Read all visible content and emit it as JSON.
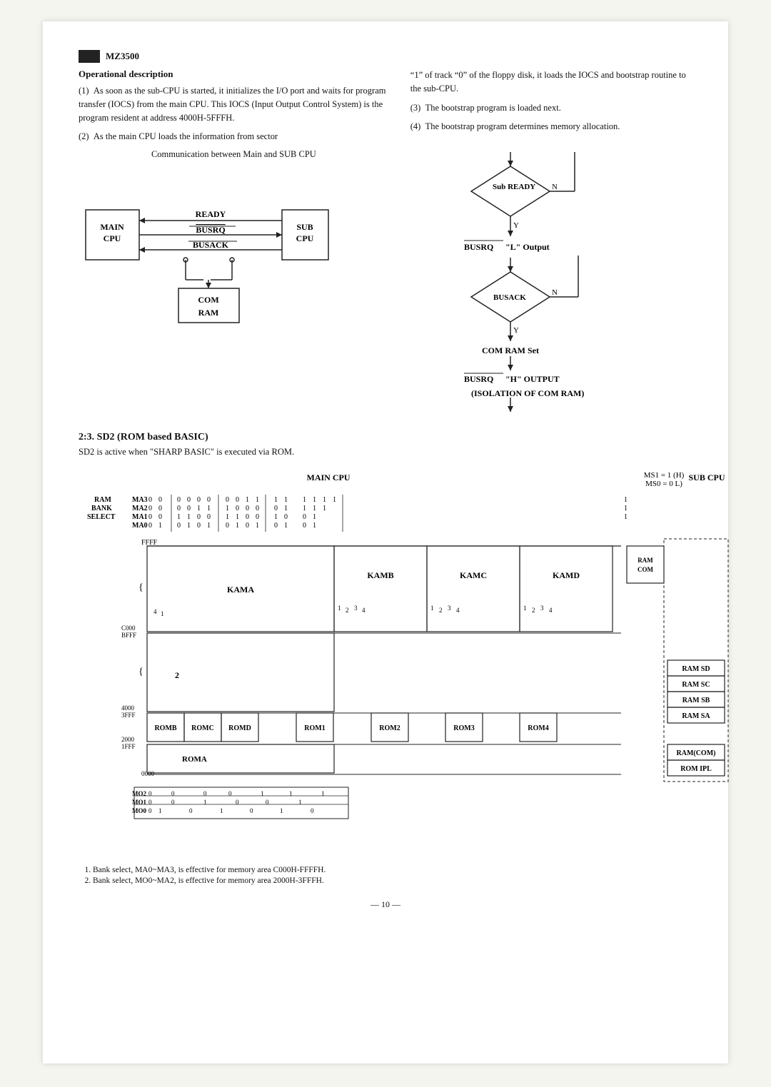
{
  "header": {
    "logo_alt": "MZ3500 logo bar",
    "model": "MZ3500"
  },
  "operational": {
    "title": "Operational description",
    "items": [
      "(1)  As soon as the sub-CPU is started, it initializes the I/O port and waits for program transfer (IOCS) from the main CPU. This IOCS (Input Output Control System) is the program resident at address 4000H-5FFFH.",
      "(2)  As the main CPU loads the information from sector",
      "\"1\" of track \"0\" of the floppy disk, it loads the IOCS and bootstrap routine to the sub-CPU.",
      "(3)  The bootstrap program is loaded next.",
      "(4)  The bootstrap program determines memory allocation."
    ]
  },
  "comm_diagram": {
    "title": "Communication between Main and SUB CPU",
    "main_cpu": "MAIN\nCPU",
    "sub_cpu": "SUB\nCPU",
    "signal1": "READY",
    "signal2": "BUSRQ",
    "signal3": "BUSACK",
    "com_ram": "COM\nRAM"
  },
  "flowchart": {
    "node1": "Sub  READY",
    "n_label1": "N",
    "y_label1": "Y",
    "signal_output": "BUSRQ  \"L\"  Output",
    "node2": "BUSACK",
    "n_label2": "N",
    "y_label2": "Y",
    "action1": "COM  RAM Set",
    "signal_output2": "BUSRQ  \"H\"  OUTPUT",
    "action2": "(ISOLATION OF COM RAM)"
  },
  "section23": {
    "title": "2:3.  SD2 (ROM based BASIC)",
    "description": "SD2 is active when \"SHARP BASIC\" is executed via ROM."
  },
  "memory_diagram": {
    "main_cpu_label": "MAIN   CPU",
    "sub_cpu_label": "SUB CPU",
    "ms1": "MS1 = 1 (H)",
    "ms0": "MS0 = 0  L)",
    "ram_bank": {
      "label": "RAM\nBANK\nSELECT",
      "rows": [
        {
          "sig": "MA3",
          "vals": [
            "0",
            "0",
            "",
            "0",
            "0",
            "0",
            "0",
            "",
            "0",
            "0",
            "1",
            "1",
            "",
            "1",
            "1",
            "1",
            "1",
            "",
            "",
            "1"
          ]
        },
        {
          "sig": "MA2",
          "vals": [
            "0",
            "0",
            "",
            "0",
            "0",
            "1",
            "1",
            "",
            "1",
            "0",
            "0",
            "0",
            "",
            "0",
            "1",
            "1",
            "1",
            "",
            "",
            "1"
          ]
        },
        {
          "sig": "MA1",
          "vals": [
            "0",
            "0",
            "",
            "1",
            "1",
            "0",
            "0",
            "",
            "1",
            "1",
            "0",
            "0",
            "",
            "1",
            "0",
            "0",
            "1",
            "",
            "",
            "1"
          ]
        },
        {
          "sig": "MA0",
          "vals": [
            "0",
            "1",
            "",
            "0",
            "1",
            "0",
            "1",
            "",
            "0",
            "1",
            "0",
            "1",
            "",
            "0",
            "1",
            "0",
            "1",
            "",
            "",
            ""
          ]
        }
      ]
    },
    "addresses": {
      "ffff": "FFFF",
      "c000_bfff": "C000\nBFFF",
      "4000_3fff": "4000\n3FFF",
      "2000_1fff": "2000\n1FFF",
      "0000": "0000"
    },
    "blocks": {
      "kama": "KAMA",
      "kamb": "KAMB",
      "kamc": "KAMC",
      "kamd": "KAMD",
      "romb": "ROMB",
      "romc": "ROMC",
      "romd": "ROMD",
      "rom1": "ROM1",
      "rom2": "ROM2",
      "rom3": "ROM3",
      "rom4": "ROM4",
      "roma": "ROMA"
    },
    "sub_blocks": {
      "ram_com": "RAM\nCOM",
      "ram_sd": "RAM SD",
      "ram_sc": "RAM SC",
      "ram_sb": "RAM SB",
      "ram_sa": "RAM SA",
      "ramcom": "RAM(COM)",
      "rom_ipl": "ROM IPL"
    },
    "mo_rows": [
      {
        "sig": "MO2",
        "vals": [
          "0",
          "",
          "0",
          "",
          "0",
          "0",
          "",
          "1",
          "",
          "1",
          "",
          "1"
        ]
      },
      {
        "sig": "MO1",
        "vals": [
          "0",
          "",
          "0",
          "",
          "1",
          "",
          "0",
          "",
          "0",
          "",
          "1"
        ]
      },
      {
        "sig": "MO0",
        "vals": [
          "0",
          "",
          "1",
          "",
          "0",
          "",
          "1",
          "",
          "0",
          "",
          "1",
          "",
          "0"
        ]
      }
    ]
  },
  "footnotes": [
    "Bank select, MA0~MA3, is effective for memory area C000H-FFFFH.",
    "Bank select, MO0~MA2, is effective for memory area 2000H-3FFFH."
  ],
  "page_number": "— 10 —"
}
